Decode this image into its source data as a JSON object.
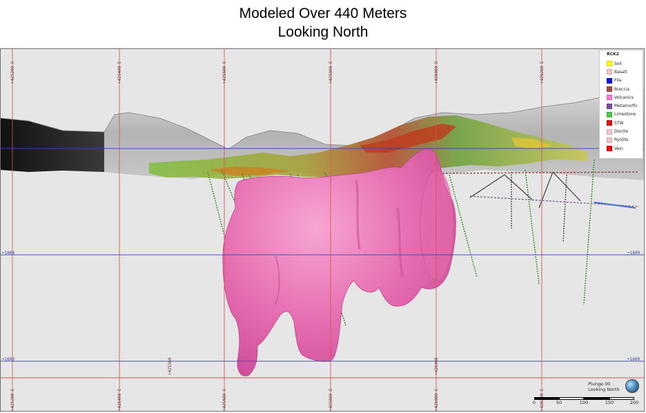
{
  "title": {
    "line1": "Modeled Over 440 Meters",
    "line2": "Looking North"
  },
  "grid": {
    "easting_labels": [
      "+425200 E",
      "+425400 E",
      "+425600 E",
      "+425800 E",
      "+426000 E",
      "+426200 E"
    ],
    "elevation_labels_left": [
      "+1800",
      "+1600"
    ],
    "elevation_labels_right": [
      "+1800",
      "+1600"
    ],
    "inner_labels": [
      "+425560",
      "+426000"
    ]
  },
  "legend": {
    "title": "RCK2",
    "items": [
      {
        "label": "Soil",
        "color": "#ffff00"
      },
      {
        "label": "Basalt",
        "color": "#f6c4cc"
      },
      {
        "label": "Flla",
        "color": "#1414e6"
      },
      {
        "label": "Breccia",
        "color": "#b04848"
      },
      {
        "label": "Volcanics",
        "color": "#ff7ad0"
      },
      {
        "label": "Metamorfic",
        "color": "#7a4fa3"
      },
      {
        "label": "Limestone",
        "color": "#4cc84c"
      },
      {
        "label": "STW",
        "color": "#e01010"
      },
      {
        "label": "Diorite",
        "color": "#f4c6d6"
      },
      {
        "label": "Ryolite",
        "color": "#f4c0c8"
      },
      {
        "label": "Vein",
        "color": "#ff0000"
      }
    ]
  },
  "scale": {
    "plunge": "Plunge 00",
    "looking": "Looking North",
    "ticks": [
      "0",
      "50",
      "100",
      "150",
      "200"
    ]
  },
  "colors": {
    "grid_red": "#d65252",
    "grid_blue": "#4040c0",
    "body_pink": "#e86ab0",
    "background": "#e6e6e6"
  }
}
